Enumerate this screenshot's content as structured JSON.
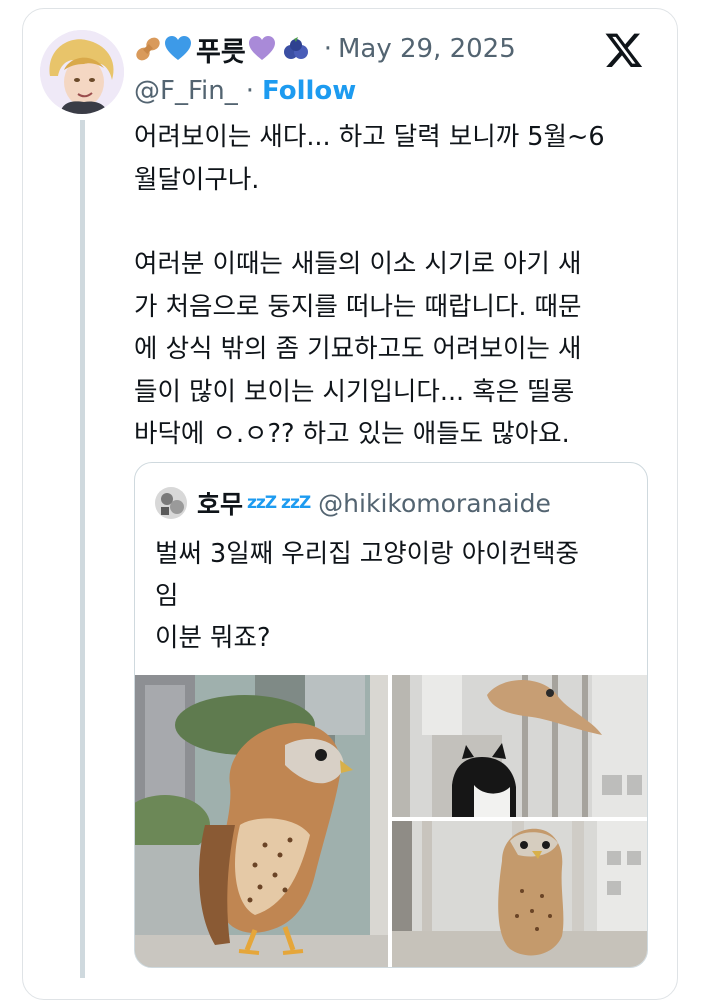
{
  "tweet": {
    "display_name": "푸릇",
    "emojis": [
      "peanut-emoji",
      "blue-heart-emoji",
      "purple-heart-emoji",
      "blueberry-emoji"
    ],
    "separator": "·",
    "date": "May 29, 2025",
    "handle": "@F_Fin_",
    "handle_separator": "·",
    "follow_label": "Follow",
    "lines": [
      "어려보이는 새다... 하고 달력 보니까 5월~6",
      "월달이구나.",
      "",
      "여러분 이때는 새들의 이소 시기로 아기 새",
      "가 처음으로 둥지를 떠나는 때랍니다. 때문",
      "에 상식 밖의 좀 기묘하고도 어려보이는 새",
      "들이 많이 보이는 시기입니다... 혹은 띨롱",
      "바닥에 ㅇ.ㅇ?? 하고 있는 애들도 많아요."
    ]
  },
  "quote": {
    "display_name": "호무",
    "sleep_glyph": "zzZ zzZ",
    "handle": "@hikikomoranaide",
    "lines": [
      "벌써 3일째 우리집 고양이랑 아이컨택중",
      "임",
      "이분 뭐죠?"
    ]
  },
  "colors": {
    "link": "#1d9bf0",
    "secondary_text": "#536471",
    "border": "#cfd9de"
  }
}
